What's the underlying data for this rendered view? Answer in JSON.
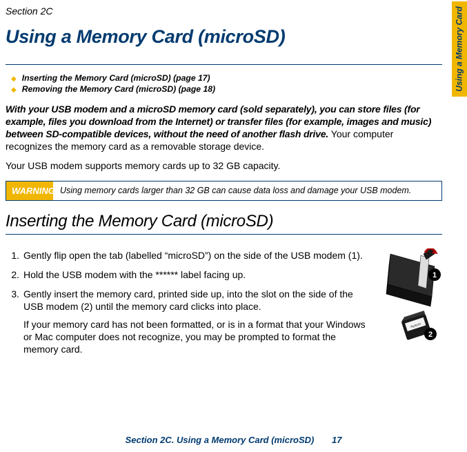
{
  "section_label": "Section 2C",
  "title": "Using a Memory Card (microSD)",
  "toc": [
    "Inserting the Memory Card (microSD) (page 17)",
    "Removing the Memory Card (microSD) (page 18)"
  ],
  "intro_bold": "With your USB modem and a microSD memory card (sold separately), you can store files (for example, files you download from the Internet) or transfer files (for example, images and music) between SD-compatible devices, without the need of another flash drive.",
  "intro_rest": " Your computer recognizes the memory card as a removable storage device.",
  "capacity_line": "Your USB modem supports memory cards up to 32 GB capacity.",
  "warning_label": "WARNING",
  "warning_text": "Using memory cards larger than 32 GB can cause data loss and damage your USB modem.",
  "subheading": "Inserting the Memory Card (microSD)",
  "steps": [
    {
      "num": "1.",
      "text": "Gently flip open the tab (labelled “microSD”) on the side of the USB modem (1)."
    },
    {
      "num": "2.",
      "text": "Hold the USB modem with the ****** label facing up."
    },
    {
      "num": "3.",
      "text": "Gently insert the memory card, printed side up, into the slot on the side of the USB modem (2) until the memory card clicks into place.",
      "extra": "If your memory card has not been formatted, or is in a format that your Windows or Mac computer does not recognize, you may be prompted to format the memory card."
    }
  ],
  "footer_text": "Section 2C. Using a Memory Card (microSD)",
  "footer_page": "17",
  "side_tab": "Using a Memory Card",
  "callouts": {
    "one": "1",
    "two": "2"
  }
}
